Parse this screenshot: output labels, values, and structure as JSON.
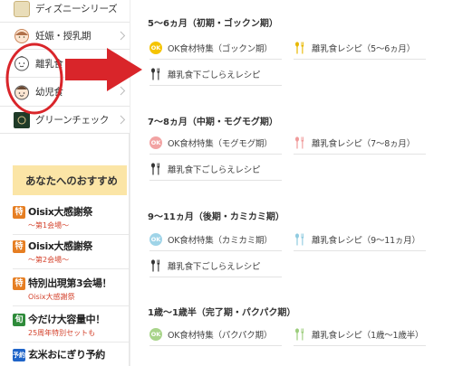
{
  "sidebar": {
    "categories": [
      {
        "label": "ディズニーシリーズ",
        "icon": "disney-logo-icon"
      },
      {
        "label": "妊娠・授乳期",
        "icon": "mother-face-icon"
      },
      {
        "label": "離乳食",
        "icon": "baby-face-icon"
      },
      {
        "label": "幼児食",
        "icon": "toddler-face-icon"
      },
      {
        "label": "グリーンチェック",
        "icon": "green-check-logo-icon"
      }
    ],
    "recommend_heading": "あなたへのおすすめ",
    "promos": [
      {
        "badge": "特",
        "title": "Oisix大感謝祭",
        "sub": "～第1会場～"
      },
      {
        "badge": "特",
        "title": "Oisix大感謝祭",
        "sub": "～第2会場～"
      },
      {
        "badge": "特",
        "title": "特別出現第3会場！",
        "sub": "Oisix大感謝祭"
      },
      {
        "badge": "旬",
        "title": "今だけ大容量中！",
        "sub": "25周年特別セットも"
      },
      {
        "badge": "予約",
        "title": "玄米おにぎり予約",
        "sub": ""
      }
    ]
  },
  "panel": {
    "sections": [
      {
        "title": "5〜6ヵ月（初期・ゴックン期）",
        "ok_label": "OK食材特集（ゴックン期）",
        "recipe_label": "離乳食レシピ（5〜6ヵ月）",
        "prep_label": "離乳食下ごしらえレシピ",
        "ok_color": "#f5c400",
        "recipe_color": "#e8b800"
      },
      {
        "title": "7〜8ヵ月（中期・モグモグ期）",
        "ok_label": "OK食材特集（モグモグ期）",
        "recipe_label": "離乳食レシピ（7〜8ヵ月）",
        "prep_label": "離乳食下ごしらえレシピ",
        "ok_color": "#f2a3a3",
        "recipe_color": "#f09a9a"
      },
      {
        "title": "9〜11ヵ月（後期・カミカミ期）",
        "ok_label": "OK食材特集（カミカミ期）",
        "recipe_label": "離乳食レシピ（9〜11ヵ月）",
        "prep_label": "離乳食下ごしらえレシピ",
        "ok_color": "#9fd4e8",
        "recipe_color": "#8fcbe0"
      },
      {
        "title": "1歳〜1歳半（完了期・パクパク期）",
        "ok_label": "OK食材特集（パクパク期）",
        "recipe_label": "離乳食レシピ（1歳〜1歳半）",
        "ok_color": "#a8d48a",
        "recipe_color": "#9ccd7c"
      }
    ],
    "ok_badge_text": "OK"
  },
  "colors": {
    "annotation_red": "#d9252a",
    "recommend_bg": "#fbe5a6",
    "promo_sub_red": "#d4432d"
  }
}
